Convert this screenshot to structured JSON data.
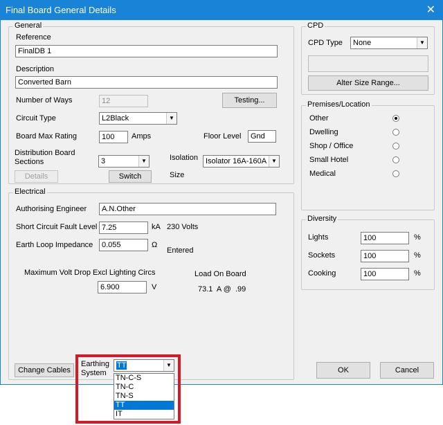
{
  "window": {
    "title": "Final Board General Details"
  },
  "general": {
    "legend": "General",
    "reference_label": "Reference",
    "reference_value": "FinalDB 1",
    "description_label": "Description",
    "description_value": "Converted Barn",
    "ways_label": "Number of Ways",
    "ways_value": "12",
    "testing_button": "Testing...",
    "circuit_type_label": "Circuit Type",
    "circuit_type_value": "L2Black",
    "board_max_label": "Board Max Rating",
    "board_max_value": "100",
    "amps_label": "Amps",
    "floor_level_label": "Floor Level",
    "floor_level_value": "Gnd",
    "dist_sections_label_line1": "Distribution Board",
    "dist_sections_label_line2": "Sections",
    "dist_sections_value": "3",
    "isolation_label": "Isolation",
    "isolation_value": "Isolator 16A-160A",
    "size_label": "Size",
    "details_button": "Details",
    "switch_button": "Switch"
  },
  "electrical": {
    "legend": "Electrical",
    "engineer_label": "Authorising Engineer",
    "engineer_value": "A.N.Other",
    "fault_label": "Short Circuit Fault Level",
    "fault_value": "7.25",
    "fault_unit": "kA",
    "volts_label": "230 Volts",
    "loop_label": "Earth Loop Impedance",
    "loop_value": "0.055",
    "loop_unit": "Ω",
    "entered_label": "Entered",
    "volt_drop_label": "Maximum Volt Drop Excl Lighting Circs",
    "volt_drop_value": "6.900",
    "volt_drop_unit": "V",
    "load_label": "Load On Board",
    "load_value": "73.1  A @  .99"
  },
  "cpd": {
    "legend": "CPD",
    "type_label": "CPD Type",
    "type_value": "None",
    "alter_button": "Alter Size Range..."
  },
  "premises": {
    "legend": "Premises/Location",
    "options": [
      {
        "label": "Other",
        "checked": true
      },
      {
        "label": "Dwelling",
        "checked": false
      },
      {
        "label": "Shop / Office",
        "checked": false
      },
      {
        "label": "Small Hotel",
        "checked": false
      },
      {
        "label": "Medical",
        "checked": false
      }
    ]
  },
  "diversity": {
    "legend": "Diversity",
    "rows": [
      {
        "label": "Lights",
        "value": "100",
        "unit": "%"
      },
      {
        "label": "Sockets",
        "value": "100",
        "unit": "%"
      },
      {
        "label": "Cooking",
        "value": "100",
        "unit": "%"
      }
    ]
  },
  "footer": {
    "change_cables_button": "Change Cables",
    "earthing_label_line1": "Earthing",
    "earthing_label_line2": "System",
    "earthing_value": "TT",
    "earthing_options": [
      "TN-C-S",
      "TN-C",
      "TN-S",
      "TT",
      "IT"
    ],
    "earthing_selected_index": 3,
    "ok_button": "OK",
    "cancel_button": "Cancel"
  },
  "colors": {
    "titlebar": "#1883d7",
    "highlight": "#d41a26",
    "selection": "#0078d7"
  }
}
